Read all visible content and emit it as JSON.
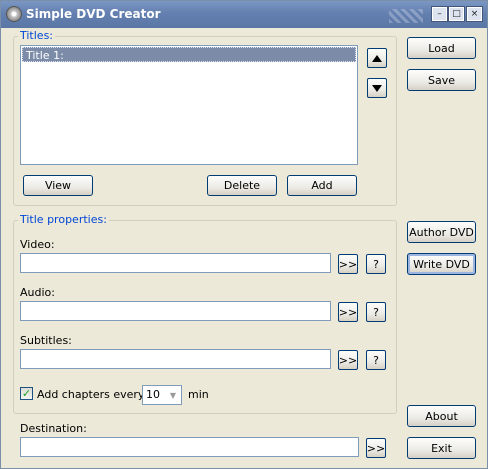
{
  "window": {
    "title": "Simple DVD Creator"
  },
  "titlebar_buttons": {
    "minimize": "–",
    "maximize": "□",
    "close": "×"
  },
  "titles": {
    "group_label": "Titles:",
    "items": [
      "Title 1:"
    ],
    "view_label": "View",
    "delete_label": "Delete",
    "add_label": "Add"
  },
  "side": {
    "load_label": "Load",
    "save_label": "Save",
    "author_label": "Author DVD",
    "write_label": "Write DVD",
    "about_label": "About",
    "exit_label": "Exit"
  },
  "properties": {
    "group_label": "Title properties:",
    "video_label": "Video:",
    "video_value": "",
    "audio_label": "Audio:",
    "audio_value": "",
    "subtitles_label": "Subtitles:",
    "subtitles_value": "",
    "browse_label": ">>",
    "help_label": "?",
    "chapters_label": "Add chapters every",
    "chapters_checked": true,
    "chapters_value": "10",
    "chapters_unit": "min"
  },
  "destination": {
    "label": "Destination:",
    "value": "",
    "browse_label": ">>"
  }
}
